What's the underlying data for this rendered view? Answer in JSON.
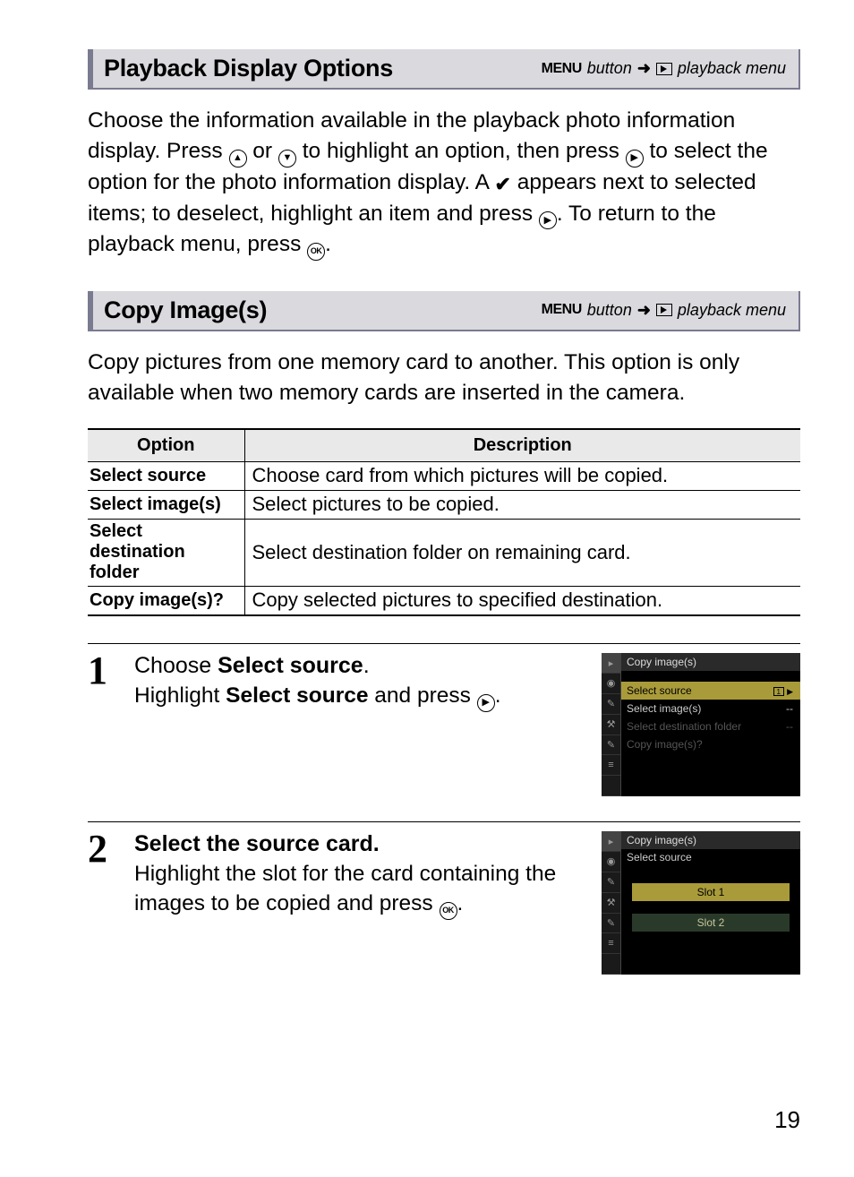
{
  "section1": {
    "title": "Playback Display Options",
    "breadcrumb_menu": "MENU",
    "breadcrumb_button": "button",
    "breadcrumb_target": "playback menu"
  },
  "para1_a": "Choose the information available in the playback photo information display.  Press ",
  "para1_b": " or ",
  "para1_c": " to highlight an option, then press ",
  "para1_d": " to select the option for the photo information display.  A ",
  "para1_e": " appears next to selected items; to deselect, highlight an item and press ",
  "para1_f": ".  To return to the playback menu, press ",
  "para1_g": ".",
  "section2": {
    "title": "Copy Image(s)",
    "breadcrumb_menu": "MENU",
    "breadcrumb_button": "button",
    "breadcrumb_target": "playback menu"
  },
  "para2": "Copy pictures from one memory card to another.  This option is only available when two memory cards are inserted in the camera.",
  "table": {
    "h1": "Option",
    "h2": "Description",
    "rows": [
      {
        "opt": "Select source",
        "desc": "Choose card from which pictures will be copied."
      },
      {
        "opt": "Select image(s)",
        "desc": "Select pictures to be copied."
      },
      {
        "opt": "Select destination folder",
        "desc": "Select destination folder on remaining card."
      },
      {
        "opt": "Copy image(s)?",
        "desc": "Copy selected pictures to specified destination."
      }
    ]
  },
  "step1": {
    "num": "1",
    "title_a": "Choose ",
    "title_b": "Select source",
    "title_c": ".",
    "body_a": "Highlight ",
    "body_b": "Select source",
    "body_c": " and press ",
    "body_d": "."
  },
  "screen1": {
    "header": "Copy image(s)",
    "r1": "Select source",
    "r1v": "",
    "r2": "Select image(s)",
    "r2v": "--",
    "r3": "Select destination folder",
    "r3v": "--",
    "r4": "Copy image(s)?"
  },
  "step2": {
    "num": "2",
    "title": "Select the source card.",
    "body_a": "Highlight the slot for the card containing the images to be copied and press ",
    "body_b": "."
  },
  "screen2": {
    "header": "Copy image(s)",
    "sub": "Select source",
    "slot1": "Slot 1",
    "slot2": "Slot 2"
  },
  "page": "19"
}
